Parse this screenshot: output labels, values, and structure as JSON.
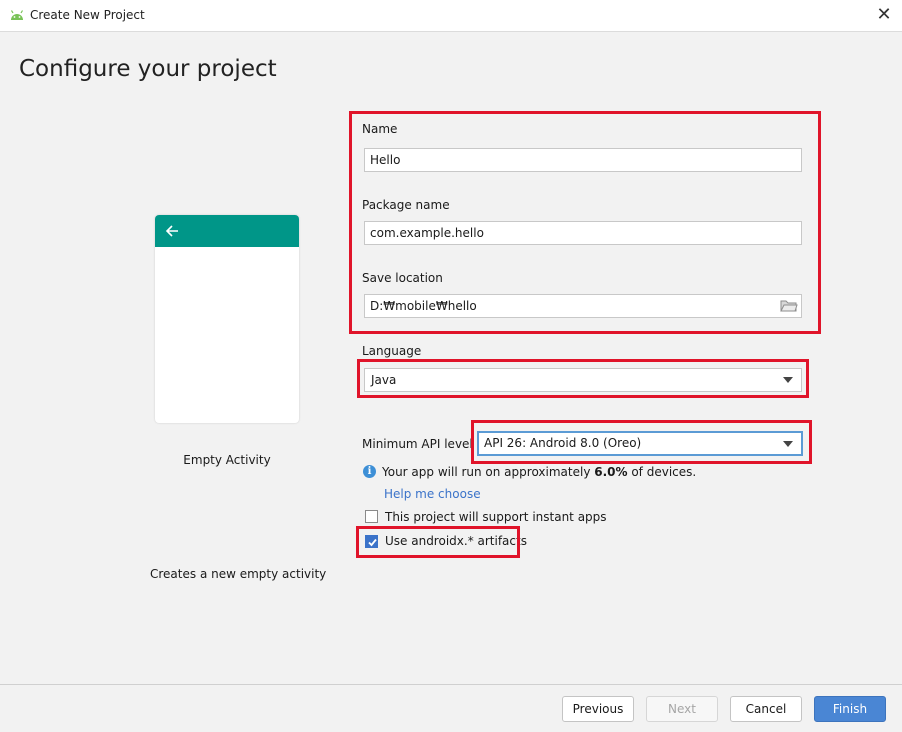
{
  "window": {
    "title": "Create New Project"
  },
  "page": {
    "heading": "Configure your project"
  },
  "template": {
    "name": "Empty Activity",
    "description": "Creates a new empty activity"
  },
  "form": {
    "name_label": "Name",
    "name_value": "Hello",
    "package_label": "Package name",
    "package_value": "com.example.hello",
    "location_label": "Save location",
    "location_value": "D:₩mobile₩hello",
    "language_label": "Language",
    "language_value": "Java",
    "api_label": "Minimum API level",
    "api_value": "API 26: Android 8.0 (Oreo)",
    "info_prefix": "Your app will run on approximately ",
    "info_percent": "6.0%",
    "info_suffix": " of devices.",
    "help_link": "Help me choose",
    "instant_apps_label": "This project will support instant apps",
    "instant_apps_checked": false,
    "androidx_label": "Use androidx.* artifacts",
    "androidx_checked": true
  },
  "buttons": {
    "previous": "Previous",
    "next": "Next",
    "cancel": "Cancel",
    "finish": "Finish"
  },
  "colors": {
    "accent": "#4a86d4",
    "appbar": "#009688",
    "highlight_box": "#e0142a"
  }
}
